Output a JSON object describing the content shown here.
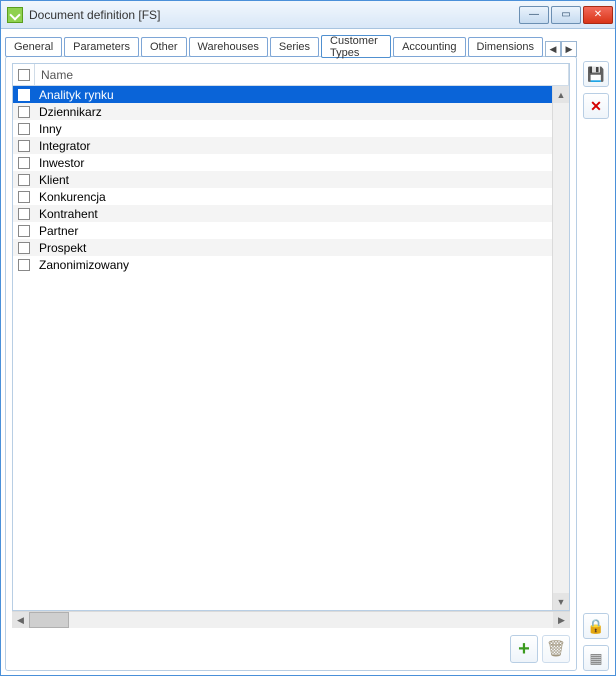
{
  "window": {
    "title": "Document definition [FS]"
  },
  "tabs": [
    {
      "label": "General",
      "active": false
    },
    {
      "label": "Parameters",
      "active": false
    },
    {
      "label": "Other",
      "active": false
    },
    {
      "label": "Warehouses",
      "active": false
    },
    {
      "label": "Series",
      "active": false
    },
    {
      "label": "Customer Types",
      "active": true
    },
    {
      "label": "Accounting",
      "active": false
    },
    {
      "label": "Dimensions",
      "active": false
    }
  ],
  "list": {
    "header": "Name",
    "rows": [
      {
        "name": "Analityk rynku",
        "checked": false,
        "selected": true
      },
      {
        "name": "Dziennikarz",
        "checked": false,
        "selected": false
      },
      {
        "name": "Inny",
        "checked": false,
        "selected": false
      },
      {
        "name": "Integrator",
        "checked": false,
        "selected": false
      },
      {
        "name": "Inwestor",
        "checked": false,
        "selected": false
      },
      {
        "name": "Klient",
        "checked": false,
        "selected": false
      },
      {
        "name": "Konkurencja",
        "checked": false,
        "selected": false
      },
      {
        "name": "Kontrahent",
        "checked": false,
        "selected": false
      },
      {
        "name": "Partner",
        "checked": false,
        "selected": false
      },
      {
        "name": "Prospekt",
        "checked": false,
        "selected": false
      },
      {
        "name": "Zanonimizowany",
        "checked": false,
        "selected": false
      }
    ]
  },
  "icons": {
    "minimize": "—",
    "maximize": "▭",
    "close": "✕",
    "tab_prev": "◀",
    "tab_next": "▶",
    "scroll_up": "▲",
    "scroll_down": "▼",
    "scroll_left": "◀",
    "scroll_right": "▶",
    "add": "+",
    "delete_item": "🗑",
    "save": "💾",
    "cancel": "✕",
    "lock": "🔒",
    "grid": "▦"
  }
}
